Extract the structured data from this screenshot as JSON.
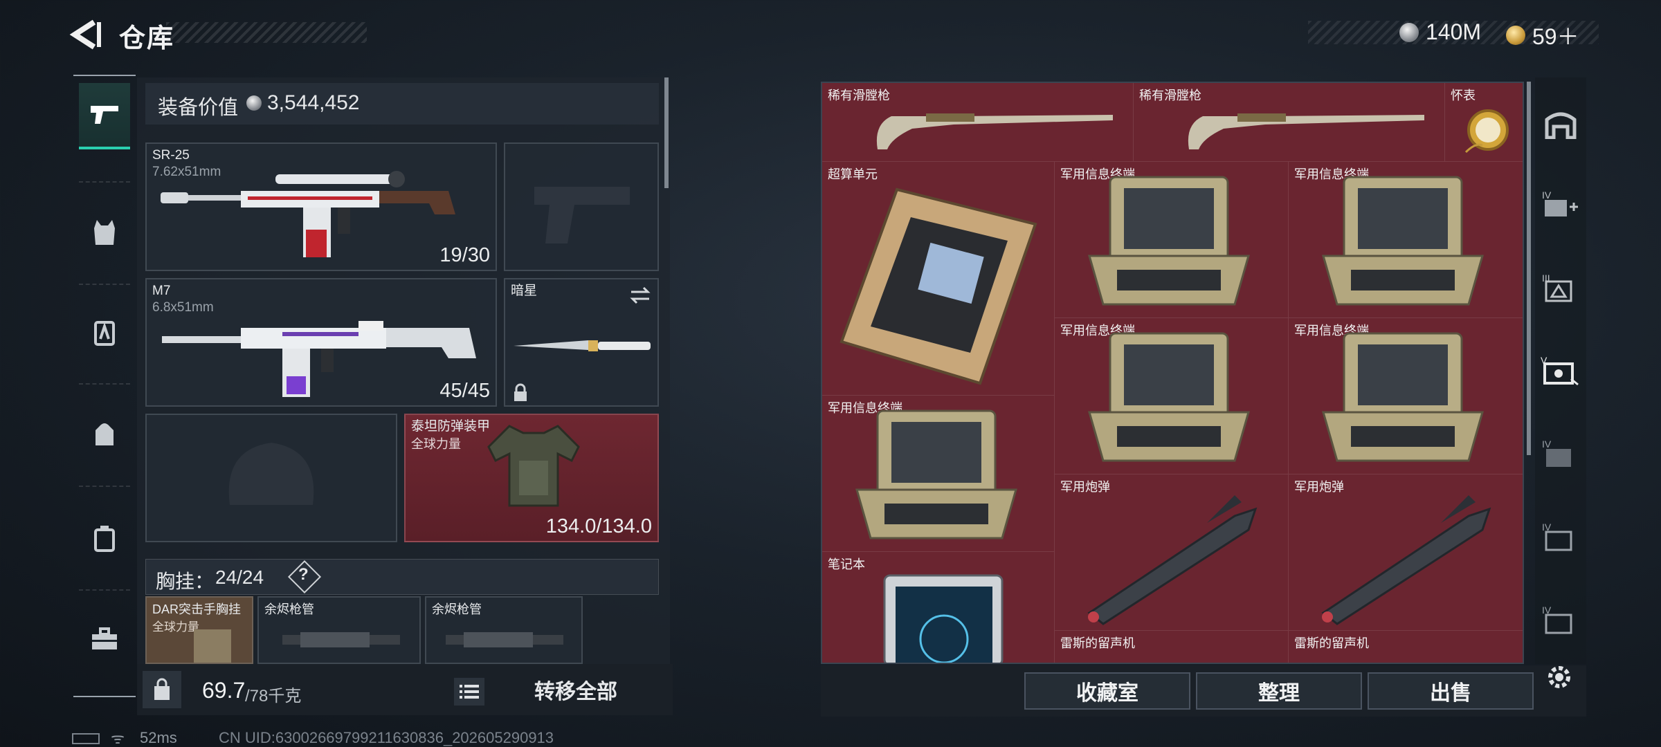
{
  "header": {
    "title": "仓库",
    "currency_silver": "140M",
    "currency_gold": "59＋"
  },
  "equipment": {
    "value_label": "装备价值",
    "value": "3,544,452",
    "primary": {
      "name": "SR-25",
      "caliber": "7.62x51mm",
      "ammo": "19/30"
    },
    "secondary": {
      "name": "M7",
      "caliber": "6.8x51mm",
      "ammo": "45/45"
    },
    "melee": {
      "name": "暗星"
    },
    "armor": {
      "name": "泰坦防弹装甲",
      "tag": "全球力量",
      "durability": "134.0/134.0"
    },
    "chest_rig": {
      "label": "胸挂：",
      "count": "24/24",
      "help": "?"
    },
    "rig_items": [
      {
        "name": "DAR突击手胸挂",
        "tag": "全球力量"
      },
      {
        "name": "余烬枪管"
      },
      {
        "name": "余烬枪管"
      }
    ]
  },
  "footer_left": {
    "weight": "69.7",
    "weight_max": "/78千克",
    "transfer_all": "转移全部"
  },
  "storage": {
    "items": [
      "稀有滑膛枪",
      "稀有滑膛枪",
      "怀表",
      "超算单元",
      "军用信息终端",
      "军用信息终端",
      "军用信息终端",
      "军用信息终端",
      "军用信息终端",
      "军用炮弹",
      "军用炮弹",
      "笔记本",
      "雷斯的留声机",
      "雷斯的留声机"
    ],
    "buttons": {
      "collection": "收藏室",
      "sort": "整理",
      "sell": "出售"
    }
  },
  "status_bar": {
    "ping": "52ms",
    "uid": "CN UID:63002669799211630836_202605290913"
  },
  "colors": {
    "accent": "#2ad0b0",
    "rare_bg": "#6a2530"
  }
}
